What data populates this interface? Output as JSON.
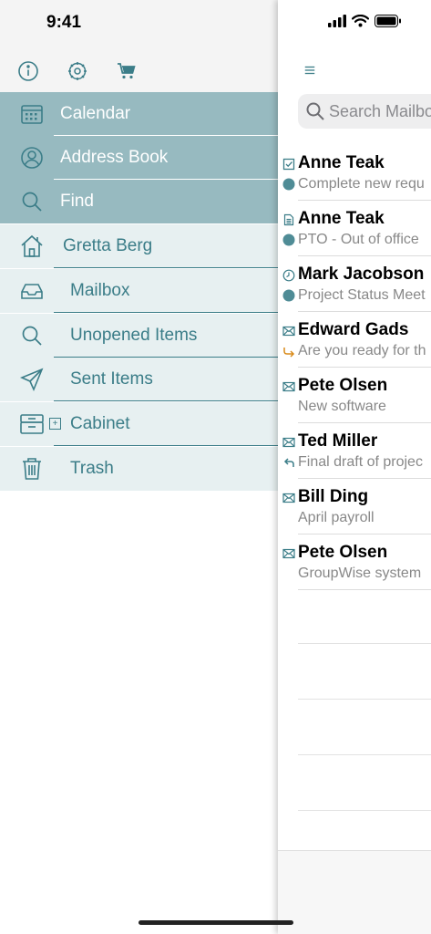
{
  "status": {
    "time": "9:41"
  },
  "colors": {
    "accent": "#3b7d88",
    "nav_selected": "#97bac0",
    "nav_light": "#e7f0f1"
  },
  "toolbar": {
    "icons": [
      "info-icon",
      "settings-icon",
      "cart-icon"
    ]
  },
  "nav": {
    "items": [
      {
        "label": "Calendar",
        "icon": "calendar-icon"
      },
      {
        "label": "Address Book",
        "icon": "contact-icon"
      },
      {
        "label": "Find",
        "icon": "search-icon"
      },
      {
        "label": "Gretta Berg",
        "icon": "home-icon"
      },
      {
        "label": "Mailbox",
        "icon": "inbox-icon"
      },
      {
        "label": "Unopened Items",
        "icon": "search-icon"
      },
      {
        "label": "Sent Items",
        "icon": "send-icon"
      },
      {
        "label": "Cabinet",
        "icon": "cabinet-icon"
      },
      {
        "label": "Trash",
        "icon": "trash-icon"
      }
    ]
  },
  "search": {
    "placeholder": "Search Mailbox"
  },
  "messages": [
    {
      "sender": "Anne Teak",
      "subject": "Complete new requ",
      "type_icon": "task-icon",
      "status_icon": "dot-icon"
    },
    {
      "sender": "Anne Teak",
      "subject": "PTO - Out of office",
      "type_icon": "note-icon",
      "status_icon": "dot-icon"
    },
    {
      "sender": "Mark Jacobson",
      "subject": "Project Status Meet",
      "type_icon": "clock-icon",
      "status_icon": "dot-icon"
    },
    {
      "sender": "Edward Gads",
      "subject": "Are you ready for th",
      "type_icon": "mail-icon",
      "status_icon": "forward-icon"
    },
    {
      "sender": "Pete Olsen",
      "subject": "New software",
      "type_icon": "mail-icon",
      "status_icon": ""
    },
    {
      "sender": "Ted Miller",
      "subject": "Final draft of projec",
      "type_icon": "mail-icon",
      "status_icon": "reply-icon"
    },
    {
      "sender": "Bill Ding",
      "subject": "April payroll",
      "type_icon": "mail-icon",
      "status_icon": ""
    },
    {
      "sender": "Pete Olsen",
      "subject": "GroupWise system",
      "type_icon": "mail-icon",
      "status_icon": ""
    }
  ]
}
